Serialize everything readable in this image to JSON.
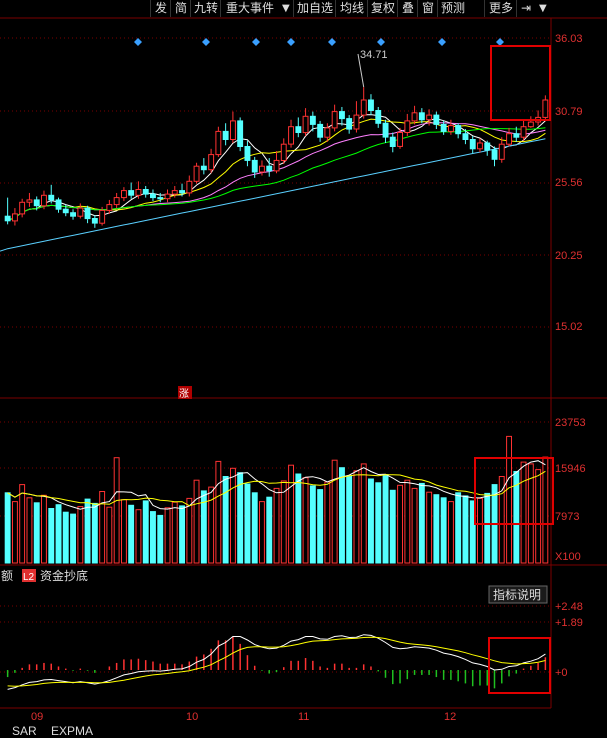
{
  "toolbar": {
    "buttons": [
      "发",
      "简",
      "九转",
      "重大事件",
      "加自选",
      "均线",
      "复权",
      "叠",
      "窗",
      "预测",
      "更多"
    ],
    "dropdown_glyph": "▼",
    "dock_icon": "⇥"
  },
  "price_panel": {
    "y_ticks": [
      "36.03",
      "30.79",
      "25.56",
      "20.25",
      "15.02"
    ],
    "high_label": "34.71",
    "limit_up_mark": "涨"
  },
  "volume_panel": {
    "y_ticks": [
      "23753",
      "15946",
      "7973"
    ],
    "unit": "X100"
  },
  "indicator_tabs": [
    "额",
    "L2",
    "资金抄底"
  ],
  "indicator_panel": {
    "button": "指标说明",
    "y_ticks": [
      "+2.48",
      "+1.89",
      "+0"
    ]
  },
  "x_labels": [
    "09",
    "10",
    "11",
    "12"
  ],
  "bottom_tabs": [
    "SAR",
    "EXPMA"
  ],
  "colors": {
    "up": "#ff3232",
    "down": "#54ffff",
    "ma5": "#ffffff",
    "ma10": "#ffff00",
    "ma20": "#ff80ff",
    "ma30": "#00ff00",
    "ma60": "#5ad0ff",
    "highlight_box": "#e00000",
    "grid": "#7a0000"
  },
  "chart_data": {
    "type": "candlestick",
    "price_axis": {
      "ylim": [
        12.0,
        37.3
      ]
    },
    "volume_axis": {
      "ylim": [
        0,
        26000
      ]
    },
    "macd_axis": {
      "ylim": [
        -0.9,
        2.7
      ]
    },
    "candles": [
      [
        23.6,
        23.2,
        25.2,
        22.9
      ],
      [
        23.2,
        23.8,
        24.3,
        22.8
      ],
      [
        23.8,
        24.8,
        25.1,
        23.5
      ],
      [
        24.8,
        25.0,
        25.6,
        24.4
      ],
      [
        25.0,
        24.5,
        25.3,
        24.1
      ],
      [
        24.5,
        25.4,
        25.8,
        24.2
      ],
      [
        25.4,
        25.0,
        26.3,
        24.7
      ],
      [
        25.0,
        24.2,
        25.2,
        23.9
      ],
      [
        24.2,
        23.9,
        24.6,
        23.6
      ],
      [
        23.9,
        23.6,
        24.2,
        23.3
      ],
      [
        23.6,
        24.3,
        24.7,
        23.4
      ],
      [
        24.3,
        23.4,
        24.5,
        23.0
      ],
      [
        23.4,
        23.0,
        23.7,
        22.6
      ],
      [
        23.0,
        24.1,
        24.4,
        22.8
      ],
      [
        24.1,
        24.6,
        25.0,
        23.8
      ],
      [
        24.6,
        25.2,
        25.6,
        24.3
      ],
      [
        25.2,
        25.8,
        26.1,
        24.9
      ],
      [
        25.8,
        25.4,
        26.5,
        25.1
      ],
      [
        25.4,
        25.9,
        26.6,
        25.1
      ],
      [
        25.9,
        25.5,
        26.2,
        25.2
      ],
      [
        25.5,
        25.2,
        25.9,
        24.9
      ],
      [
        25.2,
        25.1,
        25.6,
        24.8
      ],
      [
        25.1,
        25.5,
        25.9,
        24.8
      ],
      [
        25.5,
        25.8,
        26.2,
        25.2
      ],
      [
        25.8,
        25.6,
        26.4,
        25.3
      ],
      [
        25.6,
        26.6,
        27.1,
        25.3
      ],
      [
        26.6,
        27.9,
        28.2,
        26.4
      ],
      [
        27.9,
        27.6,
        28.6,
        27.2
      ],
      [
        27.6,
        28.9,
        29.4,
        27.3
      ],
      [
        28.9,
        30.9,
        31.3,
        28.7
      ],
      [
        30.9,
        30.2,
        31.6,
        29.7
      ],
      [
        30.2,
        31.8,
        32.6,
        29.9
      ],
      [
        31.8,
        29.6,
        32.1,
        29.2
      ],
      [
        29.6,
        28.4,
        30.1,
        27.9
      ],
      [
        28.4,
        27.4,
        28.7,
        26.9
      ],
      [
        27.4,
        27.9,
        28.4,
        27.1
      ],
      [
        27.9,
        27.5,
        28.6,
        27.0
      ],
      [
        27.5,
        28.4,
        29.2,
        27.3
      ],
      [
        28.4,
        29.8,
        30.3,
        28.1
      ],
      [
        29.8,
        31.3,
        31.9,
        29.5
      ],
      [
        31.3,
        30.8,
        32.1,
        30.4
      ],
      [
        30.8,
        32.2,
        32.9,
        30.5
      ],
      [
        32.2,
        31.5,
        32.6,
        30.9
      ],
      [
        31.5,
        30.4,
        31.8,
        30.0
      ],
      [
        30.4,
        31.2,
        31.6,
        30.0
      ],
      [
        31.2,
        32.6,
        33.2,
        30.9
      ],
      [
        32.6,
        32.0,
        33.0,
        31.4
      ],
      [
        32.0,
        31.1,
        32.3,
        30.7
      ],
      [
        31.1,
        32.3,
        33.5,
        30.8
      ],
      [
        32.3,
        33.6,
        34.71,
        32.0
      ],
      [
        33.6,
        32.7,
        34.1,
        32.3
      ],
      [
        32.7,
        31.6,
        33.0,
        31.2
      ],
      [
        31.6,
        30.4,
        31.9,
        29.9
      ],
      [
        30.4,
        29.6,
        30.8,
        29.1
      ],
      [
        29.6,
        30.8,
        31.2,
        29.4
      ],
      [
        30.8,
        31.8,
        32.4,
        30.5
      ],
      [
        31.8,
        32.5,
        33.1,
        31.5
      ],
      [
        32.5,
        31.9,
        32.9,
        31.6
      ],
      [
        31.9,
        32.3,
        32.8,
        31.4
      ],
      [
        32.3,
        31.5,
        32.6,
        31.1
      ],
      [
        31.5,
        30.9,
        31.8,
        30.6
      ],
      [
        30.9,
        31.4,
        31.9,
        30.6
      ],
      [
        31.4,
        30.7,
        31.6,
        30.3
      ],
      [
        30.7,
        30.2,
        31.1,
        29.8
      ],
      [
        30.2,
        29.4,
        30.5,
        29.0
      ],
      [
        29.4,
        29.9,
        30.3,
        29.1
      ],
      [
        29.9,
        29.3,
        30.1,
        28.8
      ],
      [
        29.3,
        28.5,
        29.6,
        27.9
      ],
      [
        28.5,
        29.8,
        30.4,
        28.2
      ],
      [
        29.8,
        30.7,
        31.2,
        29.6
      ],
      [
        30.7,
        30.4,
        31.3,
        30.0
      ],
      [
        30.4,
        31.3,
        31.8,
        30.1
      ],
      [
        31.3,
        31.7,
        32.2,
        31.2
      ],
      [
        31.7,
        32.1,
        32.7,
        31.4
      ],
      [
        32.1,
        33.6,
        34.0,
        31.9
      ]
    ],
    "volume": [
      11200,
      9800,
      12500,
      10400,
      9600,
      10800,
      8700,
      9300,
      8100,
      7800,
      9000,
      10200,
      9500,
      11400,
      8900,
      16800,
      10100,
      9200,
      8500,
      9900,
      8200,
      7600,
      8800,
      9700,
      9100,
      10300,
      13200,
      11500,
      12100,
      16200,
      13800,
      15100,
      14400,
      12600,
      11200,
      9800,
      10500,
      11900,
      13100,
      15600,
      14200,
      13600,
      12300,
      11700,
      12900,
      16400,
      15200,
      13900,
      14700,
      15800,
      13400,
      12800,
      14100,
      11600,
      12400,
      13200,
      11900,
      12700,
      11300,
      10900,
      10400,
      9800,
      11200,
      10700,
      9900,
      10300,
      11100,
      12500,
      13800,
      20200,
      14600,
      16100,
      15800,
      14900,
      16900
    ],
    "macd_diff": [
      -0.55,
      -0.5,
      -0.42,
      -0.35,
      -0.33,
      -0.28,
      -0.27,
      -0.3,
      -0.33,
      -0.36,
      -0.33,
      -0.36,
      -0.4,
      -0.36,
      -0.3,
      -0.22,
      -0.14,
      -0.1,
      -0.05,
      -0.03,
      -0.02,
      -0.03,
      -0.01,
      0.02,
      0.03,
      0.1,
      0.22,
      0.3,
      0.45,
      0.68,
      0.78,
      0.95,
      0.95,
      0.85,
      0.72,
      0.65,
      0.6,
      0.62,
      0.7,
      0.82,
      0.86,
      0.95,
      0.95,
      0.88,
      0.87,
      0.95,
      0.97,
      0.92,
      0.93,
      1.0,
      0.98,
      0.9,
      0.78,
      0.64,
      0.6,
      0.62,
      0.66,
      0.64,
      0.62,
      0.56,
      0.48,
      0.44,
      0.38,
      0.3,
      0.2,
      0.16,
      0.1,
      0.0,
      0.02,
      0.1,
      0.12,
      0.2,
      0.25,
      0.32,
      0.45
    ],
    "macd_dea": [
      -0.45,
      -0.46,
      -0.45,
      -0.43,
      -0.41,
      -0.38,
      -0.36,
      -0.35,
      -0.35,
      -0.35,
      -0.35,
      -0.35,
      -0.36,
      -0.36,
      -0.35,
      -0.32,
      -0.29,
      -0.25,
      -0.21,
      -0.17,
      -0.14,
      -0.12,
      -0.1,
      -0.07,
      -0.05,
      -0.02,
      0.03,
      0.08,
      0.15,
      0.26,
      0.36,
      0.48,
      0.58,
      0.64,
      0.66,
      0.66,
      0.65,
      0.65,
      0.66,
      0.69,
      0.73,
      0.78,
      0.82,
      0.83,
      0.84,
      0.86,
      0.88,
      0.89,
      0.9,
      0.92,
      0.93,
      0.92,
      0.89,
      0.84,
      0.79,
      0.75,
      0.73,
      0.71,
      0.69,
      0.66,
      0.62,
      0.58,
      0.54,
      0.49,
      0.43,
      0.38,
      0.32,
      0.26,
      0.21,
      0.19,
      0.17,
      0.18,
      0.19,
      0.22,
      0.27
    ]
  }
}
